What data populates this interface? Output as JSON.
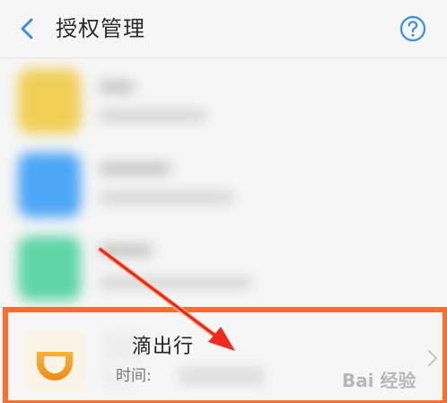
{
  "header": {
    "title": "授权管理"
  },
  "icons": {
    "back": "chevron-left-icon",
    "help": "question-circle-icon",
    "app": "didi-logo-icon",
    "row_arrow": "chevron-right-icon"
  },
  "highlighted_app": {
    "name": "滴出行",
    "auth_time_label": "时间:",
    "watermark": "Bai 经验"
  },
  "colors": {
    "accent": "#3a8ee6",
    "highlight_border": "#ff6c2c",
    "arrow": "#ee2a1c",
    "didi_orange": "#f6a623",
    "blurred_icons": [
      "#f1cf57",
      "#4da6f6",
      "#5fd5a8"
    ]
  }
}
